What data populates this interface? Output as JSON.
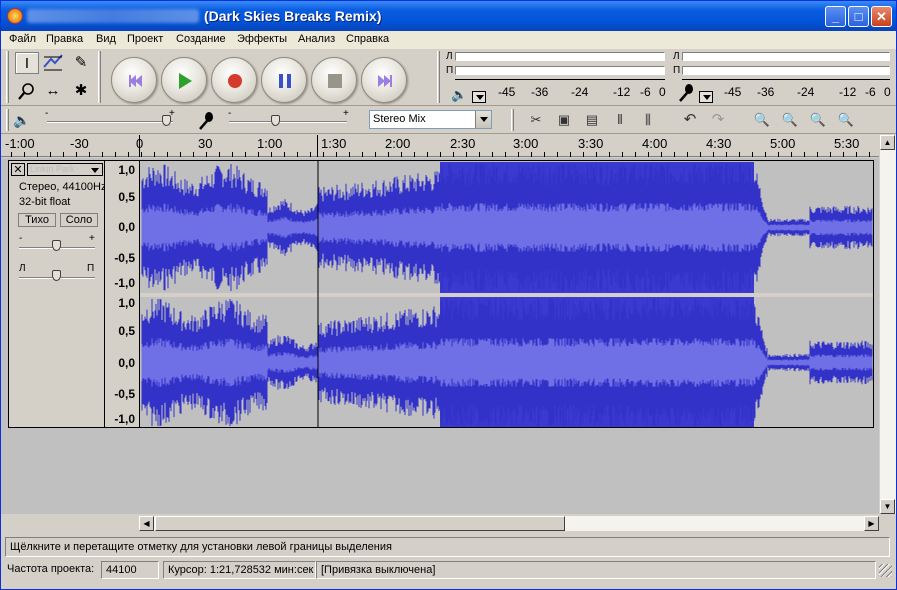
{
  "window": {
    "title": "(Dark Skies Breaks Remix)",
    "min": "_",
    "max": "□",
    "close": "✕"
  },
  "menu": [
    "Файл",
    "Правка",
    "Вид",
    "Проект",
    "Создание",
    "Эффекты",
    "Анализ",
    "Справка"
  ],
  "transport": [
    "skip-start",
    "play",
    "record",
    "pause",
    "stop",
    "skip-end"
  ],
  "colors": {
    "play": "#2ea02e",
    "record": "#d63a2a",
    "pause": "#3a52c8",
    "stop": "#9a958a",
    "skip": "#9b7fe0",
    "wave_dark": "#3232c8",
    "wave_light": "#6f6fe6",
    "wave_bg": "#c0c0c0"
  },
  "meters": {
    "out": {
      "l": "Л",
      "r": "П",
      "ticks": [
        "-45",
        "-36",
        "-24",
        "-12",
        "-6",
        "0"
      ]
    },
    "in": {
      "l": "Л",
      "r": "П",
      "ticks": [
        "-45",
        "-36",
        "-24",
        "-12",
        "-6",
        "0"
      ]
    }
  },
  "mixer": {
    "minus": "-",
    "plus": "+",
    "source": "Stereo Mix"
  },
  "ruler": [
    "-1:00",
    "-30",
    "0",
    "30",
    "1:00",
    "1:30",
    "2:00",
    "2:30",
    "3:00",
    "3:30",
    "4:00",
    "4:30",
    "5:00",
    "5:30"
  ],
  "track": {
    "close": "✕",
    "name": "Linkin Park",
    "rate": "Стерео, 44100Hz",
    "format": "32-bit float",
    "mute": "Тихо",
    "solo": "Соло",
    "gain_minus": "-",
    "gain_plus": "+",
    "pan_left": "Л",
    "pan_right": "П",
    "scale": [
      "1,0",
      "0,5",
      "0,0",
      "-0,5",
      "-1,0"
    ]
  },
  "hint": "Щёлкните и перетащите отметку для установки левой границы выделения",
  "status": {
    "rate_label": "Частота проекта:",
    "rate_value": "44100",
    "cursor": "Курсор: 1:21,728532 мин:сек",
    "snap": "[Привязка выключена]"
  }
}
